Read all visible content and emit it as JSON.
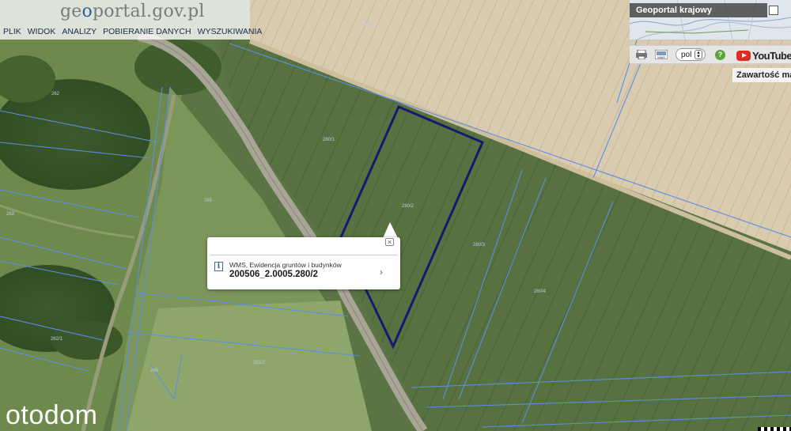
{
  "header": {
    "logo_text_grey_1": "ge",
    "logo_text_accent": "o",
    "logo_text_grey_2": "portal.gov.pl",
    "menu": [
      {
        "label": "PLIK"
      },
      {
        "label": "WIDOK"
      },
      {
        "label": "ANALIZY"
      },
      {
        "label": "POBIERANIE DANYCH"
      },
      {
        "label": "WYSZUKIWANIA"
      }
    ]
  },
  "geoportal_box": {
    "title": "Geoportal krajowy"
  },
  "toolbar": {
    "icons": [
      "print-icon",
      "wms-icon"
    ],
    "language": "pol",
    "help_label": "?",
    "youtube_label": "YouTube"
  },
  "content_panel": {
    "label": "Zawartość ma"
  },
  "popup": {
    "layer": "WMS, Ewidencja gruntów i budynków",
    "parcel_id": "200506_2.0005.280/2",
    "close_label": "×",
    "arrow": "›"
  },
  "parcel_labels": [
    "280/1",
    "280/2",
    "280/3",
    "280/4",
    "281/1",
    "281/2",
    "262",
    "262/1",
    "263",
    "265",
    "266"
  ],
  "watermark": "otodom",
  "colors": {
    "parcel_highlight": "#17196e",
    "parcel_boundary": "#5b8ee6",
    "field_green": "#566f3f",
    "field_light": "#d8c9ab",
    "road": "#9e9a90"
  }
}
